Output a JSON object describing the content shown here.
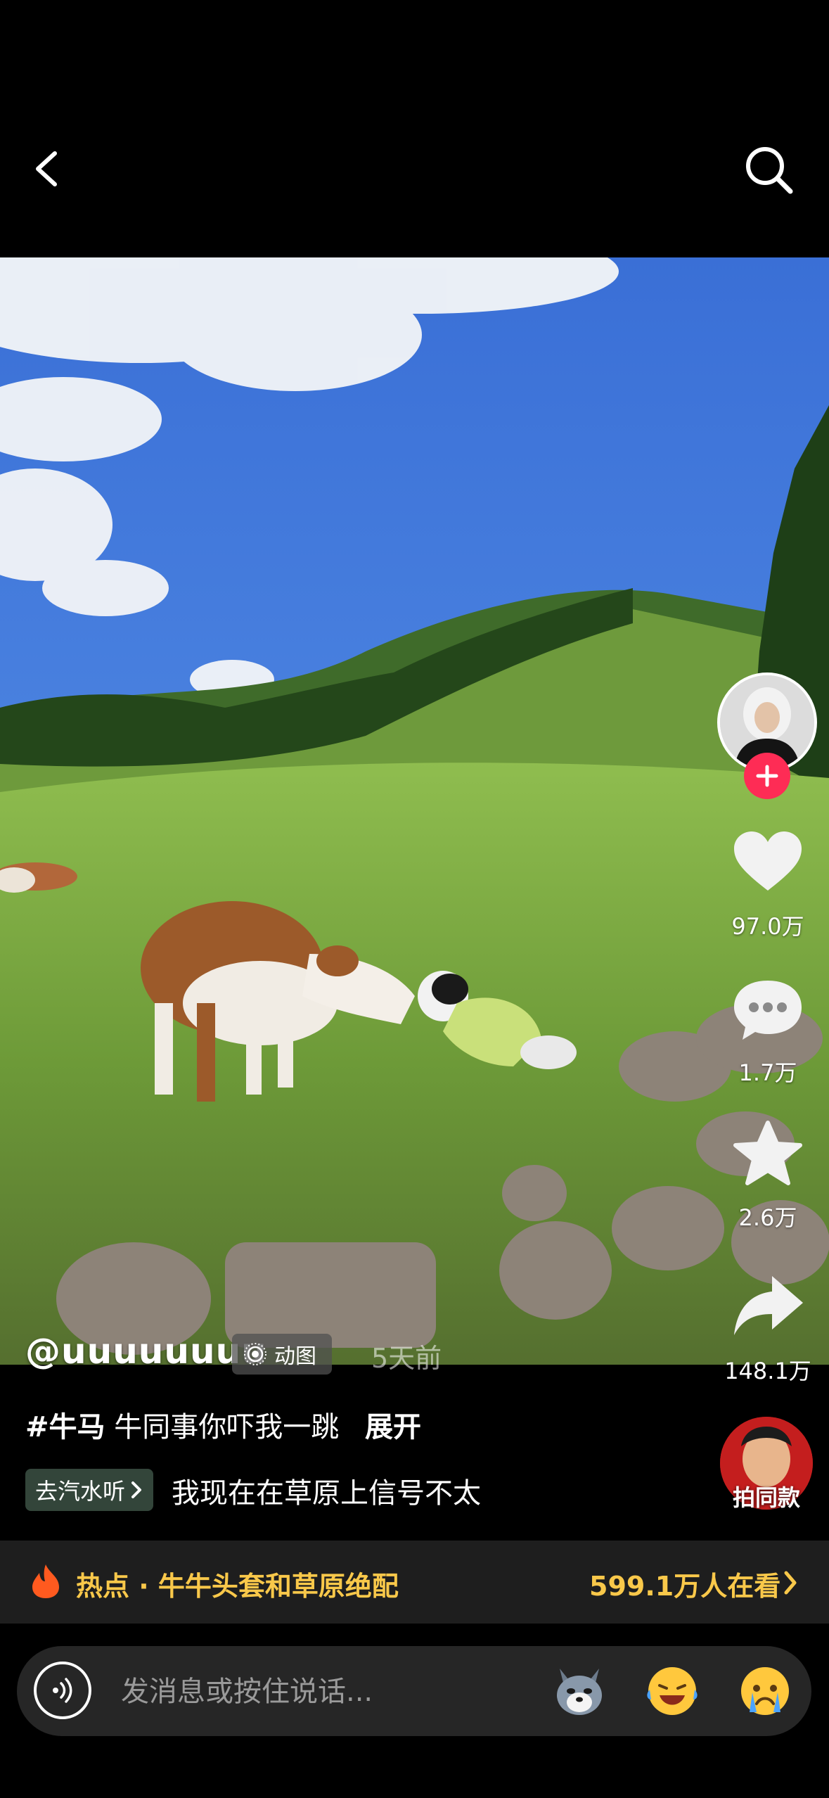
{
  "top_bar": {
    "back_icon": "chevron-left-icon",
    "search_icon": "search-icon"
  },
  "rail": {
    "like_count": "97.0万",
    "comment_count": "1.7万",
    "favorite_count": "2.6万",
    "share_count": "148.1万",
    "icons": [
      "heart-icon",
      "comment-icon",
      "star-icon",
      "share-icon"
    ]
  },
  "post": {
    "username": "@uuuuuuuu",
    "badge_label": "动图",
    "time_ago": "5天前",
    "hashtag": "#牛马",
    "caption": "牛同事你吓我一跳",
    "expand_label": "展开",
    "music_button": "去汽水听",
    "music_text": "我现在在草原上信号不太",
    "same_style_label": "拍同款"
  },
  "trending": {
    "label": "热点 · 牛牛头套和草原绝配",
    "count": "599.1万人在看"
  },
  "message": {
    "placeholder": "发消息或按住说话..."
  },
  "colors": {
    "accent_red": "#fe2c55",
    "trend_yellow": "#f9c84a",
    "background": "#000000"
  }
}
